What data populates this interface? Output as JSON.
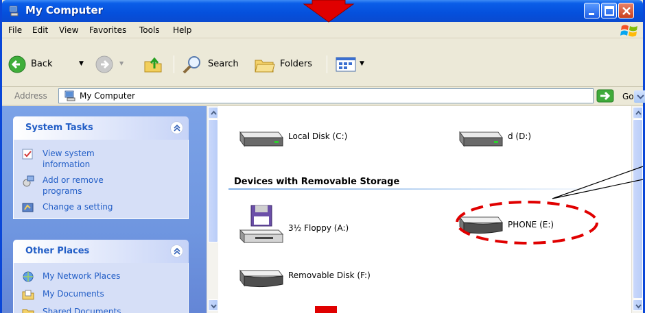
{
  "window": {
    "title": "My Computer"
  },
  "menu": {
    "items": [
      "File",
      "Edit",
      "View",
      "Favorites",
      "Tools",
      "Help"
    ]
  },
  "toolbar": {
    "back_label": "Back",
    "search_label": "Search",
    "folders_label": "Folders"
  },
  "address": {
    "label": "Address",
    "value": "My Computer",
    "go_label": "Go"
  },
  "system_tasks": {
    "title": "System Tasks",
    "items": [
      {
        "label": "View system\ninformation",
        "icon": "system-info-icon"
      },
      {
        "label": "Add or remove\nprograms",
        "icon": "add-remove-programs-icon"
      },
      {
        "label": "Change a setting",
        "icon": "control-panel-icon"
      }
    ]
  },
  "other_places": {
    "title": "Other Places",
    "items": [
      {
        "label": "My Network Places",
        "icon": "network-places-icon"
      },
      {
        "label": "My Documents",
        "icon": "my-documents-icon"
      },
      {
        "label": "Shared Documents",
        "icon": "shared-documents-icon"
      }
    ]
  },
  "drives": {
    "hard_disks": [
      {
        "label": "Local Disk (C:)",
        "icon": "hard-disk-icon"
      },
      {
        "label": "d (D:)",
        "icon": "hard-disk-icon"
      }
    ],
    "removable_section_title": "Devices with Removable Storage",
    "removable": [
      {
        "label": "3½ Floppy (A:)",
        "icon": "floppy-drive-icon"
      },
      {
        "label": "PHONE (E:)",
        "icon": "removable-disk-icon"
      },
      {
        "label": "Removable Disk (F:)",
        "icon": "removable-disk-icon"
      }
    ]
  },
  "colors": {
    "titlebar": "#0550dc",
    "task_link": "#215dc6",
    "annotation": "#e00000"
  }
}
